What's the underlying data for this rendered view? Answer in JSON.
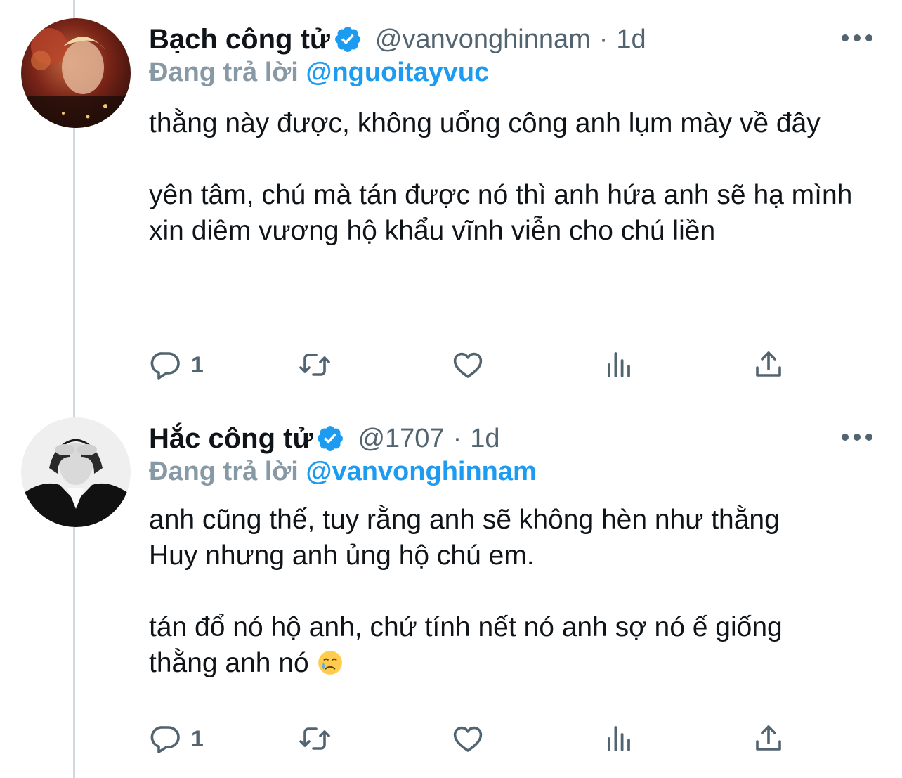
{
  "tweets": [
    {
      "display_name": "Bạch công tử",
      "handle": "@vanvonghinnam",
      "separator": "·",
      "time": "1d",
      "reply_prefix": "Đang trả lời",
      "reply_handle": "@nguoitayvuc",
      "paragraphs": [
        "thằng này được, không uổng công anh lụm mày về đây",
        "yên tâm, chú mà tán được nó thì anh hứa anh sẽ hạ mình xin diêm vương hộ khẩu vĩnh viễn cho chú liền"
      ],
      "reply_count": "1"
    },
    {
      "display_name": "Hắc công tử",
      "handle": "@1707",
      "separator": "·",
      "time": "1d",
      "reply_prefix": "Đang trả lời",
      "reply_handle": "@vanvonghinnam",
      "paragraphs": [
        "anh cũng thế, tuy rằng anh sẽ không hèn như thằng Huy nhưng anh ủng hộ chú em.",
        "tán đổ nó hộ anh, chứ tính nết nó anh sợ nó ế giống thằng anh nó"
      ],
      "emoji": "crying-face",
      "reply_count": "1"
    }
  ],
  "colors": {
    "text": "#0f1419",
    "secondary": "#536471",
    "link": "#1d9bf0",
    "verified": "#1d9bf0",
    "thread_line": "#cfd9de"
  },
  "icons": [
    "reply-icon",
    "retweet-icon",
    "like-icon",
    "analytics-icon",
    "share-icon",
    "verified-badge-icon",
    "more-icon"
  ]
}
